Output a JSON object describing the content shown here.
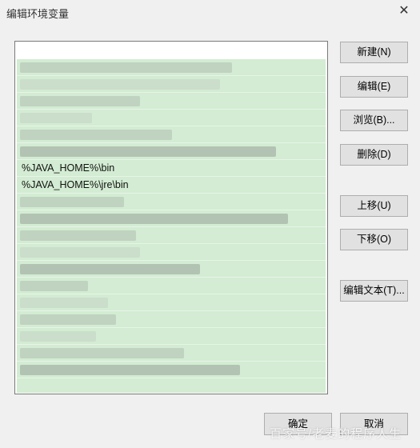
{
  "window": {
    "title": "编辑环境变量",
    "close_glyph": "✕"
  },
  "list": {
    "visible_entries": [
      "",
      "",
      "",
      "",
      "",
      "",
      "",
      "%JAVA_HOME%\\bin",
      "%JAVA_HOME%\\jre\\bin",
      "",
      "",
      "",
      "",
      "",
      "",
      "",
      "",
      "",
      "",
      ""
    ]
  },
  "buttons": {
    "new": "新建(N)",
    "edit": "编辑(E)",
    "browse": "浏览(B)...",
    "delete": "删除(D)",
    "move_up": "上移(U)",
    "move_down": "下移(O)",
    "edit_text": "编辑文本(T)...",
    "ok": "确定",
    "cancel": "取消"
  },
  "watermark": "百家号/老麦的程序人生",
  "colors": {
    "list_background": "#d3ecd3",
    "window_background": "#f0f0f0",
    "button_face": "#e1e1e1"
  }
}
